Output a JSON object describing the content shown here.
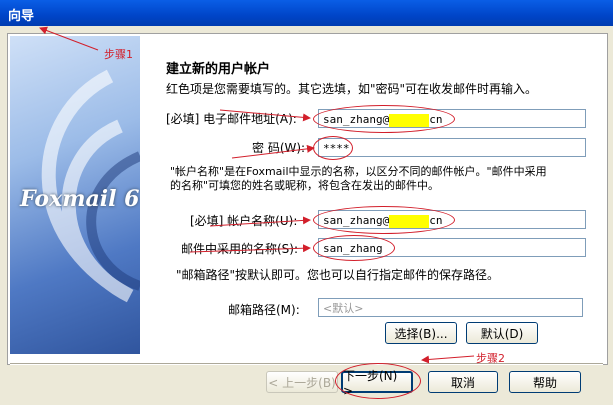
{
  "window": {
    "title": "向导"
  },
  "sidebar": {
    "logo_text": "Foxmail 6"
  },
  "annotations": {
    "step1": "步骤1",
    "step2": "步骤2"
  },
  "form": {
    "heading": "建立新的用户帐户",
    "intro": "红色项是您需要填写的。其它选填，如\"密码\"可在收发邮件时再输入。",
    "email_label": "[必填] 电子邮件地址(A):",
    "email_value_prefix": "san_zhang@",
    "email_value_suffix": "cn",
    "password_label": "密 码(W):",
    "password_value": "****",
    "account_note_line1": "\"帐户名称\"是在Foxmail中显示的名称，以区分不同的邮件帐户。\"邮件中采用",
    "account_note_line2": "的名称\"可填您的姓名或昵称，将包含在发出的邮件中。",
    "account_label": "[必填] 帐户名称(U):",
    "account_value_prefix": "san_zhang@",
    "account_value_suffix": "cn",
    "display_name_label": "邮件中采用的名称(S):",
    "display_name_value": "san_zhang",
    "mailbox_note": "\"邮箱路径\"按默认即可。您也可以自行指定邮件的保存路径。",
    "mailbox_label": "邮箱路径(M):",
    "mailbox_placeholder": "<默认>",
    "browse_button": "选择(B)...",
    "default_button": "默认(D)"
  },
  "footer": {
    "back_button": "< 上一步(B)",
    "next_button": "下一步(N) >",
    "cancel_button": "取消",
    "help_button": "帮助"
  },
  "colors": {
    "annotation_red": "#d21f2b",
    "highlight": "#ffff00",
    "title_blue": "#0045c8"
  }
}
